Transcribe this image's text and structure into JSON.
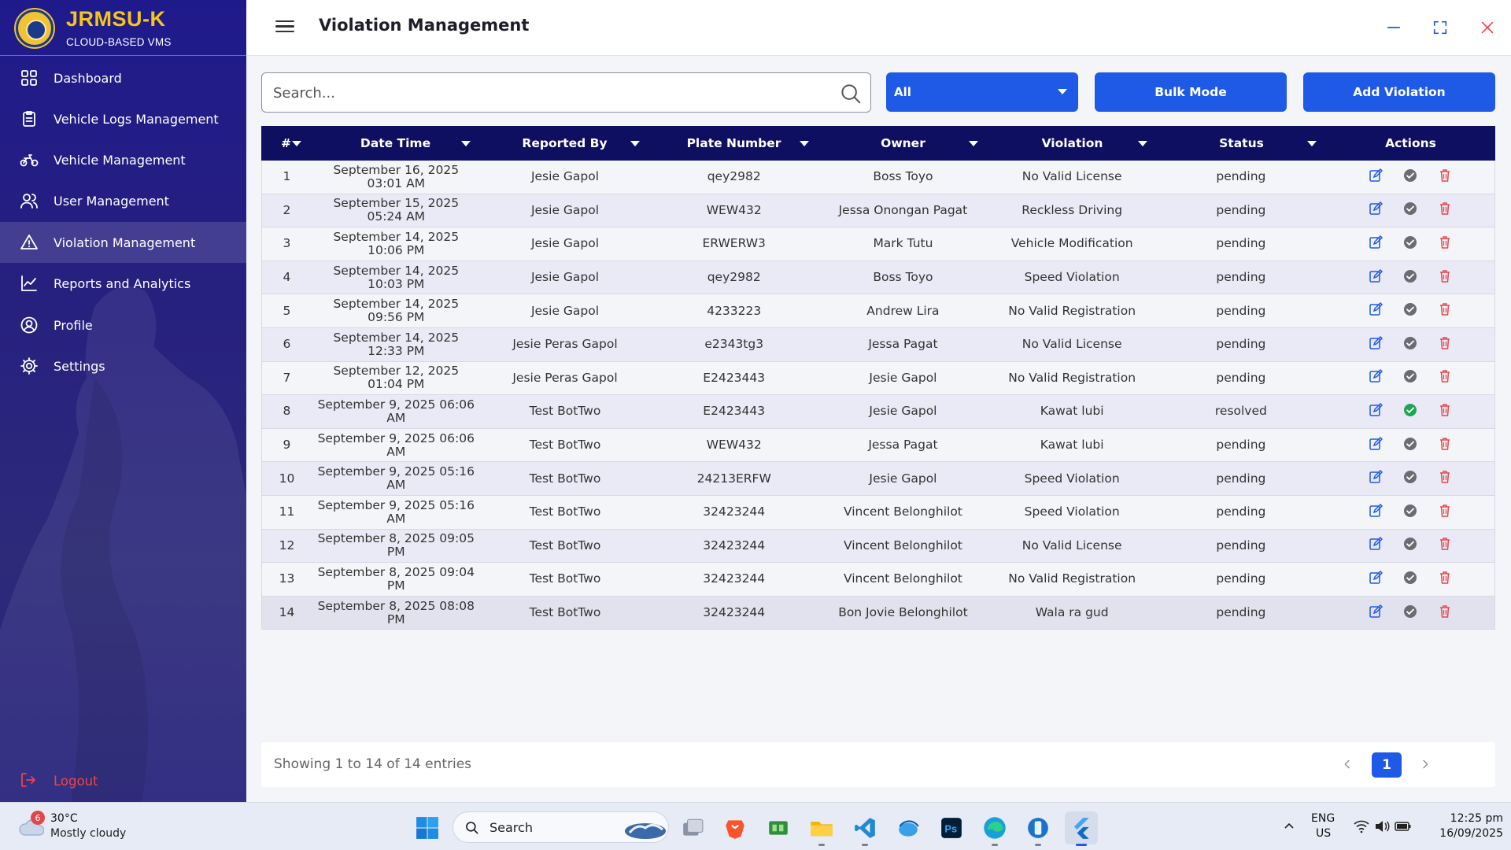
{
  "brand": {
    "title": "JRMSU-K",
    "subtitle": "CLOUD-BASED VMS"
  },
  "sidebar": {
    "items": [
      {
        "label": "Dashboard",
        "icon": "dashboard-grid-icon"
      },
      {
        "label": "Vehicle Logs Management",
        "icon": "clipboard-icon"
      },
      {
        "label": "Vehicle Management",
        "icon": "motorcycle-icon"
      },
      {
        "label": "User Management",
        "icon": "users-icon"
      },
      {
        "label": "Violation Management",
        "icon": "warning-triangle-icon",
        "active": true
      },
      {
        "label": "Reports and Analytics",
        "icon": "line-chart-icon"
      },
      {
        "label": "Profile",
        "icon": "user-circle-icon"
      },
      {
        "label": "Settings",
        "icon": "gear-icon"
      }
    ],
    "logout_label": "Logout"
  },
  "header": {
    "title": "Violation Management"
  },
  "toolbar": {
    "search_placeholder": "Search...",
    "filter_value": "All",
    "bulk_label": "Bulk Mode",
    "add_label": "Add Violation"
  },
  "table": {
    "columns": [
      "#",
      "Date Time",
      "Reported By",
      "Plate Number",
      "Owner",
      "Violation",
      "Status",
      "Actions"
    ],
    "rows": [
      {
        "n": "1",
        "date": "September 16, 2025 03:01 AM",
        "reporter": "Jesie Gapol",
        "plate": "qey2982",
        "owner": "Boss Toyo",
        "violation": "No Valid License",
        "status": "pending"
      },
      {
        "n": "2",
        "date": "September 15, 2025 05:24 AM",
        "reporter": "Jesie Gapol",
        "plate": "WEW432",
        "owner": "Jessa Onongan Pagat",
        "violation": "Reckless Driving",
        "status": "pending"
      },
      {
        "n": "3",
        "date": "September 14, 2025 10:06 PM",
        "reporter": "Jesie Gapol",
        "plate": "ERWERW3",
        "owner": "Mark Tutu",
        "violation": "Vehicle Modification",
        "status": "pending"
      },
      {
        "n": "4",
        "date": "September 14, 2025 10:03 PM",
        "reporter": "Jesie Gapol",
        "plate": "qey2982",
        "owner": "Boss Toyo",
        "violation": "Speed Violation",
        "status": "pending"
      },
      {
        "n": "5",
        "date": "September 14, 2025 09:56 PM",
        "reporter": "Jesie Gapol",
        "plate": "4233223",
        "owner": "Andrew Lira",
        "violation": "No Valid Registration",
        "status": "pending"
      },
      {
        "n": "6",
        "date": "September 14, 2025 12:33 PM",
        "reporter": "Jesie Peras Gapol",
        "plate": "e2343tg3",
        "owner": "Jessa Pagat",
        "violation": "No Valid License",
        "status": "pending"
      },
      {
        "n": "7",
        "date": "September 12, 2025 01:04 PM",
        "reporter": "Jesie Peras Gapol",
        "plate": "E2423443",
        "owner": "Jesie Gapol",
        "violation": "No Valid Registration",
        "status": "pending"
      },
      {
        "n": "8",
        "date": "September 9, 2025 06:06 AM",
        "reporter": "Test BotTwo",
        "plate": "E2423443",
        "owner": "Jesie Gapol",
        "violation": "Kawat lubi",
        "status": "resolved"
      },
      {
        "n": "9",
        "date": "September 9, 2025 06:06 AM",
        "reporter": "Test BotTwo",
        "plate": "WEW432",
        "owner": "Jessa Pagat",
        "violation": "Kawat lubi",
        "status": "pending"
      },
      {
        "n": "10",
        "date": "September 9, 2025 05:16 AM",
        "reporter": "Test BotTwo",
        "plate": "24213ERFW",
        "owner": "Jesie Gapol",
        "violation": "Speed Violation",
        "status": "pending"
      },
      {
        "n": "11",
        "date": "September 9, 2025 05:16 AM",
        "reporter": "Test BotTwo",
        "plate": "32423244",
        "owner": "Vincent Belonghilot",
        "violation": "Speed Violation",
        "status": "pending"
      },
      {
        "n": "12",
        "date": "September 8, 2025 09:05 PM",
        "reporter": "Test BotTwo",
        "plate": "32423244",
        "owner": "Vincent Belonghilot",
        "violation": "No Valid License",
        "status": "pending"
      },
      {
        "n": "13",
        "date": "September 8, 2025 09:04 PM",
        "reporter": "Test BotTwo",
        "plate": "32423244",
        "owner": "Vincent Belonghilot",
        "violation": "No Valid Registration",
        "status": "pending"
      },
      {
        "n": "14",
        "date": "September 8, 2025 08:08 PM",
        "reporter": "Test BotTwo",
        "plate": "32423244",
        "owner": "Bon Jovie Belonghilot",
        "violation": "Wala ra gud",
        "status": "pending"
      }
    ]
  },
  "footer": {
    "info": "Showing 1 to 14 of 14 entries",
    "current_page": "1"
  },
  "taskbar": {
    "weather_temp": "30°C",
    "weather_desc": "Mostly cloudy",
    "weather_badge": "6",
    "search_label": "Search",
    "lang1": "ENG",
    "lang2": "US",
    "time": "12:25 pm",
    "date": "16/09/2025"
  },
  "colors": {
    "accent": "#1f5ae6",
    "sidebar": "#221c86",
    "table_header": "#0f0f62",
    "danger": "#ef4444",
    "resolved": "#22a455"
  }
}
